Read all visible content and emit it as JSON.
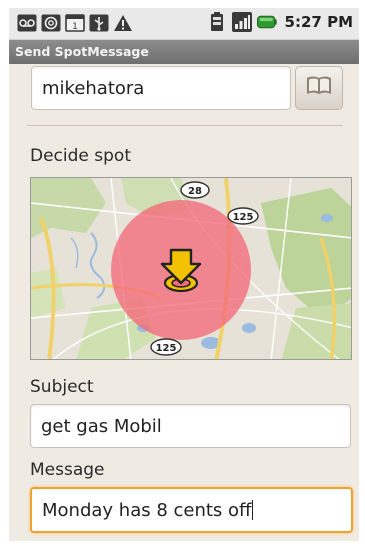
{
  "status_bar": {
    "time": "5:27 PM",
    "notification_icons": [
      "voicemail-icon",
      "at-sign-icon",
      "calendar-icon",
      "usb-icon",
      "warning-icon"
    ],
    "system_icons": [
      "battery-saver-icon",
      "signal-icon",
      "battery-icon"
    ]
  },
  "title_bar": {
    "title": "Send SpotMessage"
  },
  "recipient": {
    "value": "mikehatora",
    "contacts_button_icon": "book-icon"
  },
  "spot": {
    "label": "Decide spot",
    "map": {
      "route_badges": [
        "28",
        "125",
        "125"
      ],
      "pin_icon": "location-pin-icon"
    }
  },
  "subject": {
    "label": "Subject",
    "value": "get gas Mobil"
  },
  "message": {
    "label": "Message",
    "value": "Monday has 8 cents off"
  },
  "colors": {
    "focus_border": "#f0a030",
    "radius_fill": "#f46a7a",
    "pin": "#f2c200"
  }
}
